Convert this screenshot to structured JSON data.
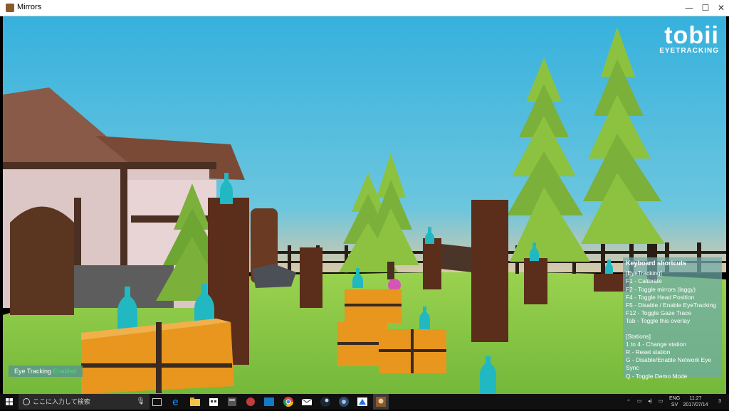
{
  "window": {
    "title": "Mirrors",
    "minimize": "—",
    "maximize": "☐",
    "close": "✕"
  },
  "brand": {
    "name": "tobii",
    "sub": "EYETRACKING"
  },
  "overlay": {
    "title": "Keyboard shortcuts",
    "eyetracking_header": "[EyeTracking]",
    "eyetracking_items": [
      "F1 - Calibrate",
      "F2 - Toggle mirrors (laggy)",
      "F4 - Toggle Head Position",
      "F5 - Disable / Enable EyeTracking",
      "F12 - Toggle Gaze Trace",
      "Tab - Toggle this overlay"
    ],
    "stations_header": "[Stations]",
    "stations_items": [
      "1 to 4 - Change station",
      "R - Reset station",
      "G - Disable/Enable Network Eye Sync",
      "Q - Toggle Demo Mode"
    ]
  },
  "status": {
    "label": "Eye Tracking",
    "state": "Enabled"
  },
  "taskbar": {
    "search_placeholder": "ここに入力して検索",
    "lang_top": "ENG",
    "lang_bottom": "SV",
    "time": "11:27",
    "date": "2017/07/14",
    "notification_count": "3",
    "icons": [
      "task-view-icon",
      "edge-icon",
      "file-explorer-icon",
      "store-icon",
      "calculator-icon",
      "app-red-icon",
      "app-blue-icon",
      "chrome-icon",
      "mail-icon",
      "steam-icon",
      "app-dark-icon",
      "app-drive-icon",
      "mirrors-game-icon"
    ]
  },
  "colors": {
    "sky": "#3fb6dc",
    "grass": "#8fcf4a",
    "hay": "#e8961e",
    "tree": "#7bb03a",
    "overlay": "#6eaaaa",
    "enabled": "#3ddc7a"
  }
}
